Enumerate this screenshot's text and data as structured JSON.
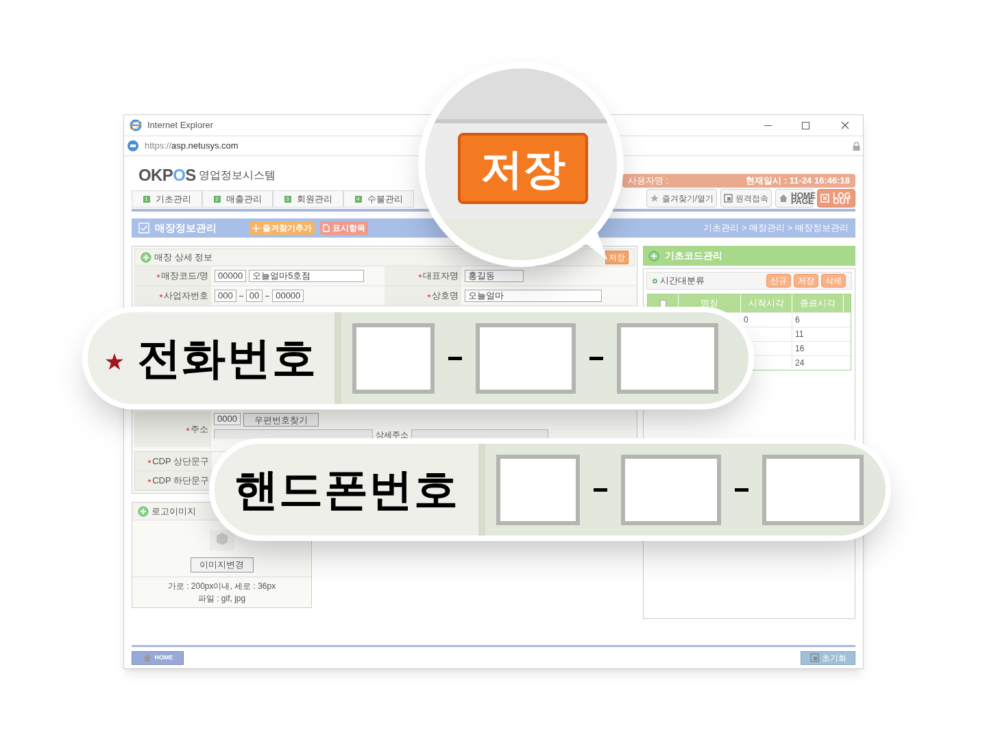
{
  "browser": {
    "title": "Internet Explorer",
    "url_scheme": "https://",
    "url_host": "asp.netusys.com"
  },
  "app": {
    "logo_a": "OKP",
    "logo_b": "O",
    "logo_c": "S",
    "subtitle": "영업정보시스템",
    "user_label": "사용자명 :",
    "datetime": "현재일시 : 11-24 16:46:18"
  },
  "menu_tabs": [
    {
      "number": "1",
      "label": "기초관리"
    },
    {
      "number": "2",
      "label": "매출관리"
    },
    {
      "number": "3",
      "label": "회원관리"
    },
    {
      "number": "4",
      "label": "수불관리"
    }
  ],
  "toolbar": [
    {
      "kind": "star",
      "label": "즐겨찾기/열기"
    },
    {
      "kind": "remote",
      "label": "원격접속"
    },
    {
      "kind": "home",
      "label": "HOME PAGE"
    },
    {
      "kind": "logout",
      "label": "LOG OUT"
    }
  ],
  "page": {
    "title": "매장정보관리",
    "actions": [
      {
        "kind": "add",
        "label": "즐겨찾기추가"
      },
      {
        "kind": "doc",
        "label": "표시항목"
      }
    ],
    "breadcrumb": "기초관리 > 매장관리 > 매장정보관리"
  },
  "store_detail": {
    "title": "매장 상세 정보",
    "save": "저장",
    "rows": [
      {
        "left": {
          "label": "매장코드/명",
          "required": true,
          "values": [
            "00000",
            "오늘얼마5호점"
          ]
        },
        "right": {
          "label": "대표자명",
          "required": true,
          "values": [
            "홍길동"
          ]
        }
      },
      {
        "left": {
          "label": "사업자번호",
          "required": true,
          "values": [
            "000",
            "00",
            "00000"
          ]
        },
        "right": {
          "label": "상호명",
          "required": true,
          "values": [
            "오늘얼마"
          ]
        }
      }
    ],
    "address": {
      "label": "주소",
      "required": true,
      "zip": "0000",
      "button": "우편번호찾기",
      "detail_label": "상세주소"
    },
    "cdp": [
      {
        "label": "CDP 상단문구",
        "required": true
      },
      {
        "label": "CDP 하단문구",
        "required": true
      }
    ]
  },
  "logo_image": {
    "title": "로고이미지",
    "button": "이미지변경",
    "notes": [
      "가로 : 200px이내, 세로 : 36px",
      "파일 : gif, jpg"
    ]
  },
  "base_code": {
    "title": "기초코드관리",
    "select_all": {
      "checked": false
    },
    "section": "시간대분류",
    "buttons": [
      "신규",
      "저장",
      "삭제"
    ],
    "columns": [
      "명칭",
      "시작시각",
      "종료시각"
    ],
    "rows": [
      {
        "start": "0",
        "end": "6"
      },
      {
        "end": "11"
      },
      {
        "end": "16"
      },
      {
        "end": "24"
      }
    ]
  },
  "footer": {
    "home": "HOME",
    "reset": "초기화"
  },
  "magnifier": {
    "button": "저장"
  },
  "callouts": [
    {
      "label": "전화번호",
      "required": true
    },
    {
      "label": "핸드폰번호",
      "required": false
    }
  ]
}
